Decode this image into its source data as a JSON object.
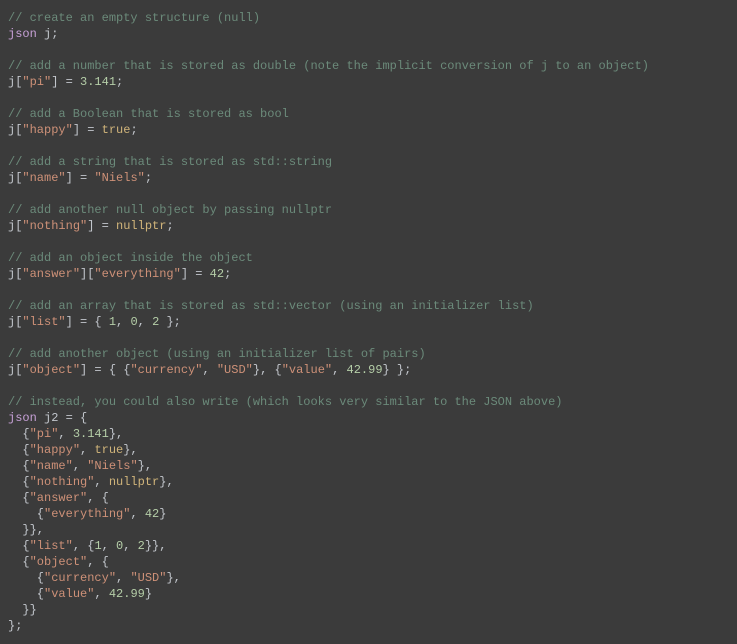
{
  "lines": [
    [
      [
        "c",
        "// create an empty structure (null)"
      ]
    ],
    [
      [
        "t",
        "json"
      ],
      [
        "p",
        " "
      ],
      [
        "id",
        "j"
      ],
      [
        "p",
        ";"
      ]
    ],
    [],
    [
      [
        "c",
        "// add a number that is stored as double (note the implicit conversion of j to an object)"
      ]
    ],
    [
      [
        "id",
        "j"
      ],
      [
        "p",
        "["
      ],
      [
        "s",
        "\"pi\""
      ],
      [
        "p",
        "] = "
      ],
      [
        "n",
        "3.141"
      ],
      [
        "p",
        ";"
      ]
    ],
    [],
    [
      [
        "c",
        "// add a Boolean that is stored as bool"
      ]
    ],
    [
      [
        "id",
        "j"
      ],
      [
        "p",
        "["
      ],
      [
        "s",
        "\"happy\""
      ],
      [
        "p",
        "] = "
      ],
      [
        "k",
        "true"
      ],
      [
        "p",
        ";"
      ]
    ],
    [],
    [
      [
        "c",
        "// add a string that is stored as std::string"
      ]
    ],
    [
      [
        "id",
        "j"
      ],
      [
        "p",
        "["
      ],
      [
        "s",
        "\"name\""
      ],
      [
        "p",
        "] = "
      ],
      [
        "s",
        "\"Niels\""
      ],
      [
        "p",
        ";"
      ]
    ],
    [],
    [
      [
        "c",
        "// add another null object by passing nullptr"
      ]
    ],
    [
      [
        "id",
        "j"
      ],
      [
        "p",
        "["
      ],
      [
        "s",
        "\"nothing\""
      ],
      [
        "p",
        "] = "
      ],
      [
        "k",
        "nullptr"
      ],
      [
        "p",
        ";"
      ]
    ],
    [],
    [
      [
        "c",
        "// add an object inside the object"
      ]
    ],
    [
      [
        "id",
        "j"
      ],
      [
        "p",
        "["
      ],
      [
        "s",
        "\"answer\""
      ],
      [
        "p",
        "]["
      ],
      [
        "s",
        "\"everything\""
      ],
      [
        "p",
        "] = "
      ],
      [
        "n",
        "42"
      ],
      [
        "p",
        ";"
      ]
    ],
    [],
    [
      [
        "c",
        "// add an array that is stored as std::vector (using an initializer list)"
      ]
    ],
    [
      [
        "id",
        "j"
      ],
      [
        "p",
        "["
      ],
      [
        "s",
        "\"list\""
      ],
      [
        "p",
        "] = { "
      ],
      [
        "n",
        "1"
      ],
      [
        "p",
        ", "
      ],
      [
        "n",
        "0"
      ],
      [
        "p",
        ", "
      ],
      [
        "n",
        "2"
      ],
      [
        "p",
        " };"
      ]
    ],
    [],
    [
      [
        "c",
        "// add another object (using an initializer list of pairs)"
      ]
    ],
    [
      [
        "id",
        "j"
      ],
      [
        "p",
        "["
      ],
      [
        "s",
        "\"object\""
      ],
      [
        "p",
        "] = { {"
      ],
      [
        "s",
        "\"currency\""
      ],
      [
        "p",
        ", "
      ],
      [
        "s",
        "\"USD\""
      ],
      [
        "p",
        "}, {"
      ],
      [
        "s",
        "\"value\""
      ],
      [
        "p",
        ", "
      ],
      [
        "n",
        "42.99"
      ],
      [
        "p",
        "} };"
      ]
    ],
    [],
    [
      [
        "c",
        "// instead, you could also write (which looks very similar to the JSON above)"
      ]
    ],
    [
      [
        "t",
        "json"
      ],
      [
        "p",
        " "
      ],
      [
        "id",
        "j2"
      ],
      [
        "p",
        " = {"
      ]
    ],
    [
      [
        "p",
        "  {"
      ],
      [
        "s",
        "\"pi\""
      ],
      [
        "p",
        ", "
      ],
      [
        "n",
        "3.141"
      ],
      [
        "p",
        "},"
      ]
    ],
    [
      [
        "p",
        "  {"
      ],
      [
        "s",
        "\"happy\""
      ],
      [
        "p",
        ", "
      ],
      [
        "k",
        "true"
      ],
      [
        "p",
        "},"
      ]
    ],
    [
      [
        "p",
        "  {"
      ],
      [
        "s",
        "\"name\""
      ],
      [
        "p",
        ", "
      ],
      [
        "s",
        "\"Niels\""
      ],
      [
        "p",
        "},"
      ]
    ],
    [
      [
        "p",
        "  {"
      ],
      [
        "s",
        "\"nothing\""
      ],
      [
        "p",
        ", "
      ],
      [
        "k",
        "nullptr"
      ],
      [
        "p",
        "},"
      ]
    ],
    [
      [
        "p",
        "  {"
      ],
      [
        "s",
        "\"answer\""
      ],
      [
        "p",
        ", {"
      ]
    ],
    [
      [
        "p",
        "    {"
      ],
      [
        "s",
        "\"everything\""
      ],
      [
        "p",
        ", "
      ],
      [
        "n",
        "42"
      ],
      [
        "p",
        "}"
      ]
    ],
    [
      [
        "p",
        "  }},"
      ]
    ],
    [
      [
        "p",
        "  {"
      ],
      [
        "s",
        "\"list\""
      ],
      [
        "p",
        ", {"
      ],
      [
        "n",
        "1"
      ],
      [
        "p",
        ", "
      ],
      [
        "n",
        "0"
      ],
      [
        "p",
        ", "
      ],
      [
        "n",
        "2"
      ],
      [
        "p",
        "}},"
      ]
    ],
    [
      [
        "p",
        "  {"
      ],
      [
        "s",
        "\"object\""
      ],
      [
        "p",
        ", {"
      ]
    ],
    [
      [
        "p",
        "    {"
      ],
      [
        "s",
        "\"currency\""
      ],
      [
        "p",
        ", "
      ],
      [
        "s",
        "\"USD\""
      ],
      [
        "p",
        "},"
      ]
    ],
    [
      [
        "p",
        "    {"
      ],
      [
        "s",
        "\"value\""
      ],
      [
        "p",
        ", "
      ],
      [
        "n",
        "42.99"
      ],
      [
        "p",
        "}"
      ]
    ],
    [
      [
        "p",
        "  }}"
      ]
    ],
    [
      [
        "p",
        "};"
      ]
    ]
  ]
}
